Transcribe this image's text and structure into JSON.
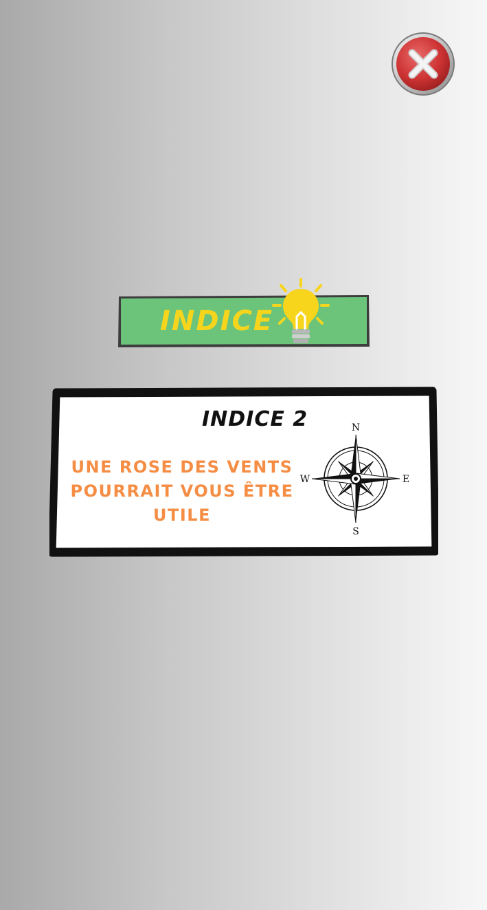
{
  "close_button": {
    "icon": "close-x-icon",
    "color": "#d23b3b"
  },
  "banner": {
    "label": "INDICE",
    "icon": "lightbulb-icon",
    "background_color": "#6cc47a",
    "text_color": "#f7d51d"
  },
  "hint_card": {
    "title": "INDICE 2",
    "text": "UNE ROSE DES VENTS POURRAIT VOUS ÊTRE UTILE",
    "text_color": "#f58d44",
    "image": "compass-rose-icon",
    "compass": {
      "north": "N",
      "south": "S",
      "east": "E",
      "west": "W"
    }
  }
}
